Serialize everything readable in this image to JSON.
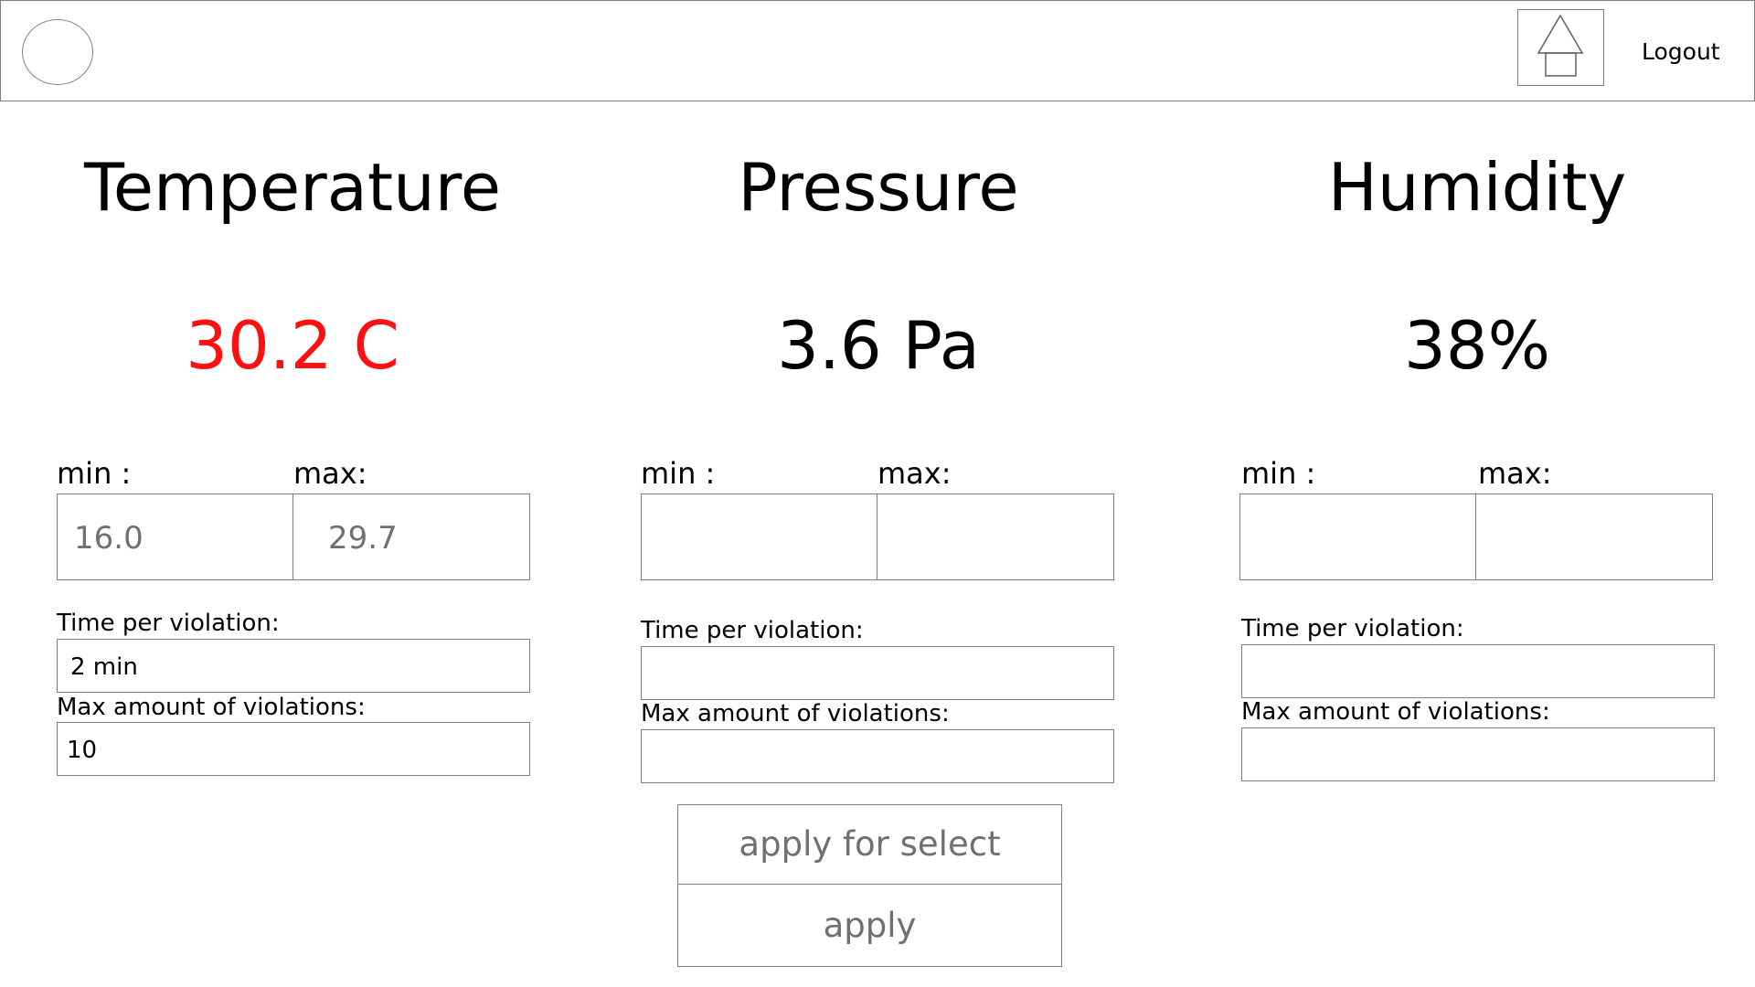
{
  "header": {
    "logout_label": "Logout"
  },
  "icons": {
    "avatar": "user-avatar-circle",
    "home": "home-icon"
  },
  "colors": {
    "alert": "#ff1010",
    "value_gray": "#707070",
    "border": "#808080"
  },
  "panels": {
    "temperature": {
      "title": "Temperature",
      "reading": "30.2 C",
      "min_label": "min :",
      "max_label": "max:",
      "min_value": "16.0",
      "max_value": "29.7",
      "time_label": "Time per violation:",
      "time_value": "2 min",
      "max_violations_label": "Max amount of violations:",
      "max_violations_value": "10"
    },
    "pressure": {
      "title": "Pressure",
      "reading": "3.6 Pa",
      "min_label": "min :",
      "max_label": "max:",
      "min_value": "",
      "max_value": "",
      "time_label": "Time per violation:",
      "time_value": "",
      "max_violations_label": "Max amount of violations:",
      "max_violations_value": ""
    },
    "humidity": {
      "title": "Humidity",
      "reading": "38%",
      "min_label": "min :",
      "max_label": "max:",
      "min_value": "",
      "max_value": "",
      "time_label": "Time per violation:",
      "time_value": "",
      "max_violations_label": "Max amount of violations:",
      "max_violations_value": ""
    }
  },
  "actions": {
    "apply_for_select_label": "apply for select",
    "apply_label": "apply"
  }
}
